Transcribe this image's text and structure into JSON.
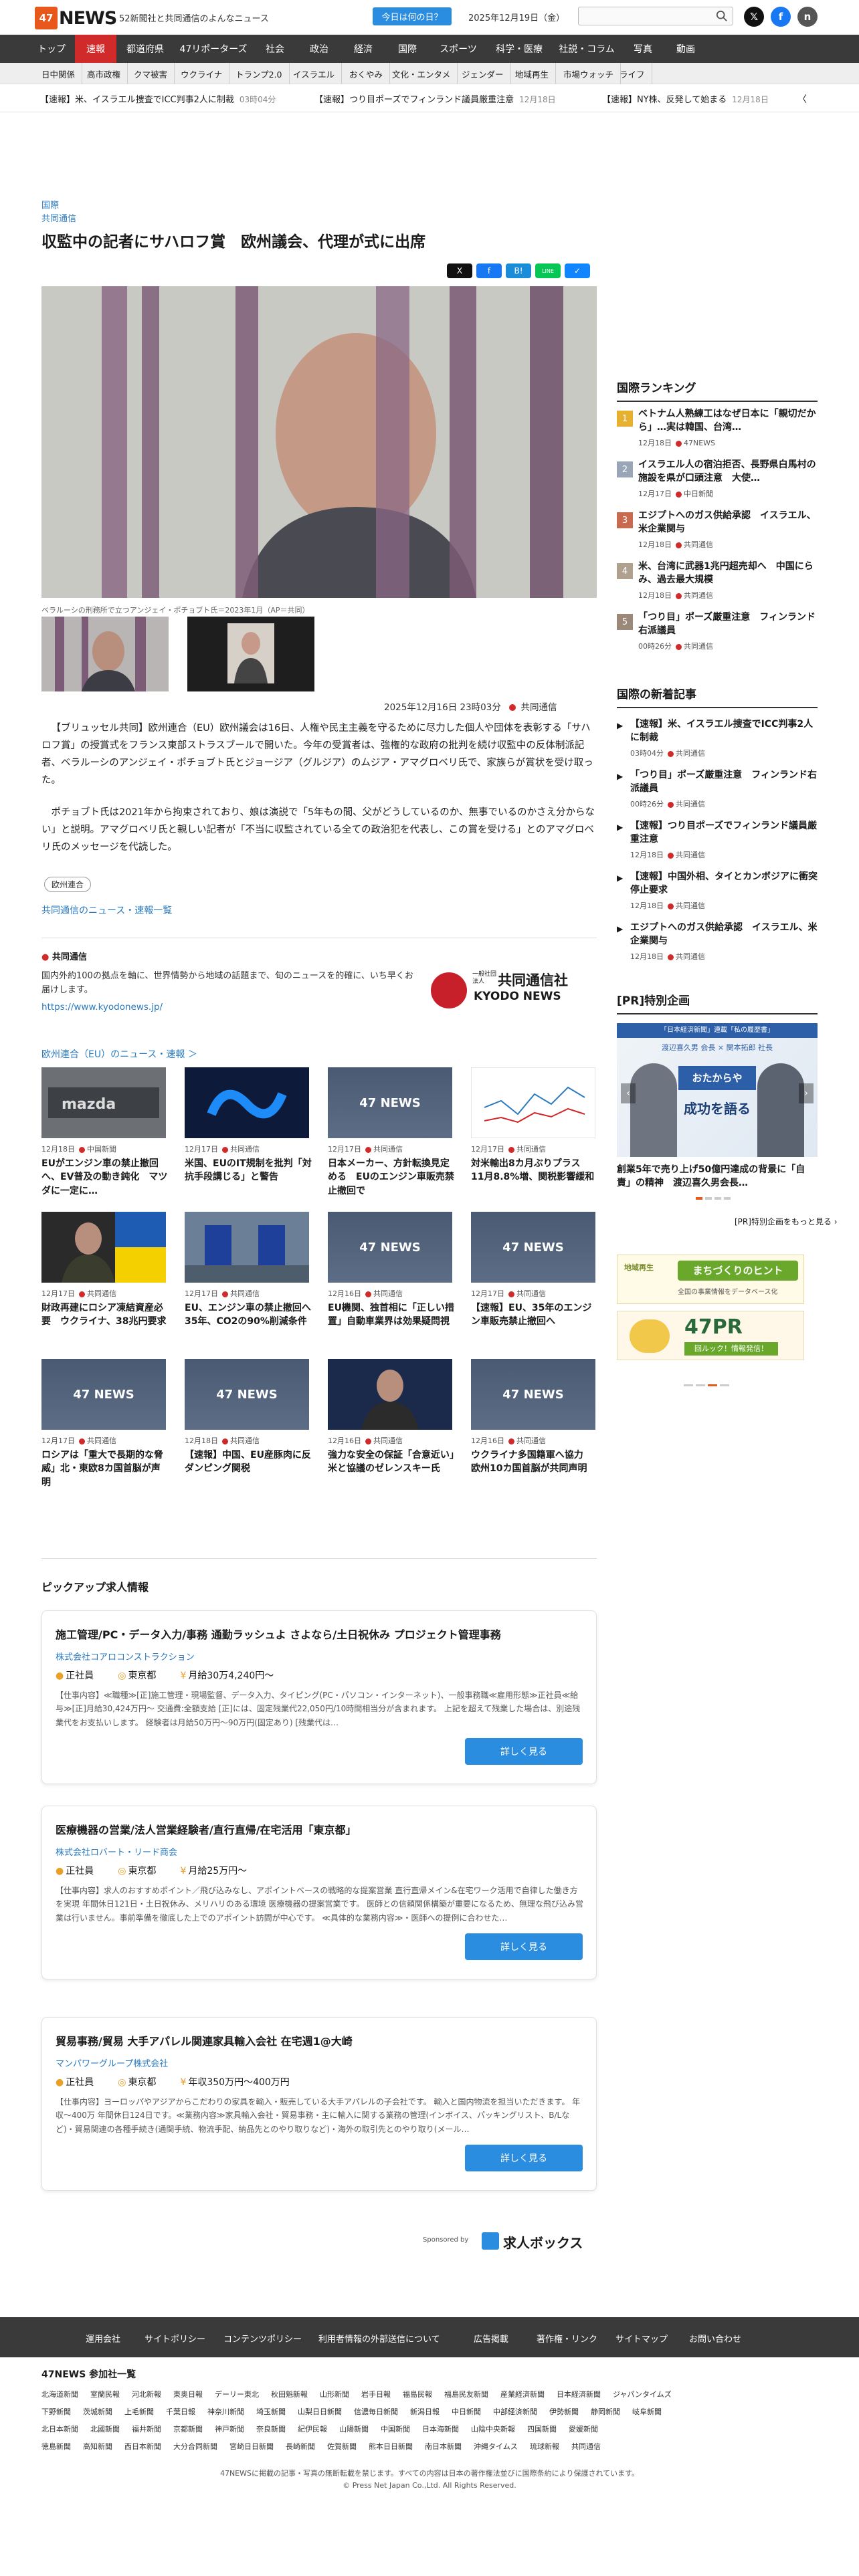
{
  "header": {
    "logo_mark": "47",
    "logo_text": "NEWS",
    "tagline": "52新聞社と共同通信のよんなニュース",
    "today_button": "今日は何の日？",
    "date": "2025年12月19日（金）",
    "search_placeholder": ""
  },
  "nav_main": [
    "トップ",
    "速報",
    "都道府県",
    "47リポーターズ",
    "社会",
    "政治",
    "経済",
    "国際",
    "スポーツ",
    "科学・医療",
    "社説・コラム",
    "写真",
    "動画"
  ],
  "nav_sub": [
    "日中関係",
    "高市政権",
    "クマ被害",
    "ウクライナ",
    "トランプ2.0",
    "イスラエル",
    "おくやみ",
    "文化・エンタメ",
    "ジェンダー",
    "地域再生",
    "市場ウォッチ",
    "ライフ"
  ],
  "ticker": [
    {
      "text": "【速報】米、イスラエル捜査でICC判事2人に制裁",
      "date": "03時04分"
    },
    {
      "text": "【速報】つり目ポーズでフィンランド議員厳重注意",
      "date": "12月18日"
    },
    {
      "text": "【速報】NY株、反発して始まる",
      "date": "12月18日"
    }
  ],
  "article": {
    "category": "国際",
    "source": "共同通信",
    "title": "収監中の記者にサハロフ賞　欧州議会、代理が式に出席",
    "caption": "ベラルーシの刑務所で立つアンジェイ・ポチョブト氏＝2023年1月（AP＝共同）",
    "datetime": "2025年12月16日 23時03分",
    "source_tag": "共同通信",
    "paragraphs": [
      "【ブリュッセル共同】欧州連合（EU）欧州議会は16日、人権や民主主義を守るために尽力した個人や団体を表彰する「サハロフ賞」の授賞式をフランス東部ストラスブールで開いた。今年の受賞者は、強権的な政府の批判を続け収監中の反体制派記者、ベラルーシのアンジェイ・ポチョブト氏とジョージア（グルジア）のムジア・アマグロベリ氏で、家族らが賞状を受け取った。",
      "ポチョブト氏は2021年から拘束されており、娘は演説で「5年もの間、父がどうしているのか、無事でいるのかさえ分からない」と説明。アマグロベリ氏と親しい記者が「不当に収監されている全ての政治犯を代表し、この賞を受ける」とのアマグロベリ氏のメッセージを代読した。"
    ],
    "tag": "欧州連合",
    "more_link": "共同通信のニュース・速報一覧",
    "share": [
      "X",
      "f",
      "B!",
      "LINE",
      "✓"
    ]
  },
  "kyodo": {
    "label": "共同通信",
    "desc": "国内外約100の拠点を軸に、世界情勢から地域の話題まで、旬のニュースを的確に、いち早くお届けします。",
    "url": "https://www.kyodonews.jp/",
    "logo_small": "一般社団法人",
    "logo_big": "共同通信社",
    "logo_en": "KYODO NEWS"
  },
  "eu_section": {
    "heading": "欧州連合（EU）のニュース・速報",
    "cards": [
      {
        "date": "12月18日",
        "src": "中国新聞",
        "title": "EUがエンジン車の禁止撤回へ、EV普及の動き鈍化　マツダに一定に…",
        "img": "mazda"
      },
      {
        "date": "12月17日",
        "src": "共同通信",
        "title": "米国、EUのIT規制を批判「対抗手段講じる」と警告",
        "img": "meta"
      },
      {
        "date": "12月17日",
        "src": "共同通信",
        "title": "日本メーカー、方針転換見定める　EUのエンジン車販売禁止撤回で",
        "img": "ph"
      },
      {
        "date": "12月17日",
        "src": "共同通信",
        "title": "対米輸出8カ月ぶりプラス　11月8.8%増、関税影響緩和",
        "img": "chart"
      },
      {
        "date": "12月17日",
        "src": "共同通信",
        "title": "財政再建にロシア凍結資産必要　ウクライナ、38兆円要求",
        "img": "zel"
      },
      {
        "date": "12月17日",
        "src": "共同通信",
        "title": "EU、エンジン車の禁止撤回へ　35年、CO2の90%削減条件",
        "img": "eu"
      },
      {
        "date": "12月16日",
        "src": "共同通信",
        "title": "EU機関、独首相に「正しい措置」自動車業界は効果疑問視",
        "img": "ph"
      },
      {
        "date": "12月17日",
        "src": "共同通信",
        "title": "【速報】EU、35年のエンジン車販売禁止撤回へ",
        "img": "ph"
      },
      {
        "date": "12月17日",
        "src": "共同通信",
        "title": "ロシアは「重大で長期的な脅威」北・東欧8カ国首脳が声明",
        "img": "ph"
      },
      {
        "date": "12月18日",
        "src": "共同通信",
        "title": "【速報】中国、EU産豚肉に反ダンピング関税",
        "img": "ph"
      },
      {
        "date": "12月16日",
        "src": "共同通信",
        "title": "強力な安全の保証「合意近い」米と協議のゼレンスキー氏",
        "img": "zel2"
      },
      {
        "date": "12月16日",
        "src": "共同通信",
        "title": "ウクライナ多国籍軍へ協力　欧州10カ国首脳が共同声明",
        "img": "ph"
      }
    ]
  },
  "ranking": {
    "heading": "国際ランキング",
    "items": [
      {
        "n": "1",
        "title": "ベトナム人熟練工はなぜ日本に「親切だから」…実は韓国、台湾…",
        "date": "12月18日",
        "src": "47NEWS"
      },
      {
        "n": "2",
        "title": "イスラエル人の宿泊拒否、長野県白馬村の施設を県が口頭注意　大使…",
        "date": "12月17日",
        "src": "中日新聞"
      },
      {
        "n": "3",
        "title": "エジプトへのガス供給承認　イスラエル、米企業関与",
        "date": "12月18日",
        "src": "共同通信"
      },
      {
        "n": "4",
        "title": "米、台湾に武器1兆円超売却へ　中国にらみ、過去最大規模",
        "date": "12月18日",
        "src": "共同通信"
      },
      {
        "n": "5",
        "title": "「つり目」ポーズ厳重注意　フィンランド右派議員",
        "date": "00時26分",
        "src": "共同通信"
      }
    ]
  },
  "newest": {
    "heading": "国際の新着記事",
    "items": [
      {
        "title": "【速報】米、イスラエル捜査でICC判事2人に制裁",
        "date": "03時04分",
        "src": "共同通信"
      },
      {
        "title": "「つり目」ポーズ厳重注意　フィンランド右派議員",
        "date": "00時26分",
        "src": "共同通信"
      },
      {
        "title": "【速報】つり目ポーズでフィンランド議員厳重注意",
        "date": "12月18日",
        "src": "共同通信"
      },
      {
        "title": "【速報】中国外相、タイとカンボジアに衝突停止要求",
        "date": "12月18日",
        "src": "共同通信"
      },
      {
        "title": "エジプトへのガス供給承認　イスラエル、米企業関与",
        "date": "12月18日",
        "src": "共同通信"
      }
    ]
  },
  "pr": {
    "heading": "[PR]特別企画",
    "banner_small": "「日本経済新聞」連載「私の履歴書」",
    "banner_names": "渡辺喜久男 会長 × 関本拓郎 社長",
    "banner_big": "おたからや",
    "banner_slogan": "成功を語る",
    "caption": "創業5年で売り上げ50億円達成の背景に「自責」の精神　渡辺喜久男会長…",
    "more": "[PR]特別企画をもっと見る",
    "ad1_small": "地域再生",
    "ad1_big": "まちづくりのヒント",
    "ad1_sub": "全国の事業情報をデータベース化",
    "ad2_big": "47PR",
    "ad2_sub": "回ルック！情報発信！"
  },
  "jobs": {
    "heading": "ピックアップ求人情報",
    "items": [
      {
        "title": "施工管理/PC・データ入力/事務 通勤ラッシュよ さよなら/土日祝休み プロジェクト管理事務",
        "company": "株式会社コアロコンストラクション",
        "type": "正社員",
        "place": "東京都",
        "pay": "月給30万4,240円〜",
        "desc": "【仕事内容】≪職種≫[正]施工管理・現場監督、データ入力、タイピング(PC・パソコン・インターネット)、一般事務職≪雇用形態≫正社員≪給与≫[正]月給30,424万円〜 交通費:全額支給 [正]には、固定残業代22,050円/10時間相当分が含まれます。 上記を超えて残業した場合は、別途残業代をお支払いします。 経験者は月給50万円〜90万円(固定あり) [残業代は…",
        "button": "詳しく見る"
      },
      {
        "title": "医療機器の営業/法人営業経験者/直行直帰/在宅活用「東京都」",
        "company": "株式会社ロバート・リード商会",
        "type": "正社員",
        "place": "東京都",
        "pay": "月給25万円〜",
        "desc": "【仕事内容】求人のおすすめポイント／飛び込みなし、アポイントベースの戦略的な提案営業 直行直帰メイン&在宅ワーク活用で自律した働き方を実現 年間休日121日・土日祝休み、メリハリのある環境 医療機器の提案営業です。 医師との信頼関係構築が重要になるため、無理な飛び込み営業は行いません。事前準備を徹底した上でのアポイント訪問が中心です。 ≪具体的な業務内容≫・医師への提例に合わせた…",
        "button": "詳しく見る"
      },
      {
        "title": "貿易事務/貿易 大手アパレル関連家具輸入会社 在宅週1@大崎",
        "company": "マンパワーグループ株式会社",
        "type": "正社員",
        "place": "東京都",
        "pay": "年収350万円〜400万円",
        "desc": "【仕事内容】ヨーロッパやアジアからこだわりの家具を輸入・販売している大手アパレルの子会社です。 輸入と国内物流を担当いただきます。 年収〜400万 年間休日124日です。≪業務内容≫家具輸入会社・貿易事務・主に輸入に関する業務の管理(インボイス、パッキングリスト、B/Lなど)・貿易関連の各種手続き(通関手続、物流手配、納品先とのやり取りなど)・海外の取引先とのやり取り(メール…",
        "button": "詳しく見る"
      }
    ],
    "sponsored": "Sponsored by",
    "sponsor": "求人ボックス"
  },
  "footer": {
    "links": [
      "運用会社",
      "サイトポリシー",
      "コンテンツポリシー",
      "利用者情報の外部送信について",
      "広告掲載",
      "著作権・リンク",
      "サイトマップ",
      "お問い合わせ"
    ],
    "partners_heading": "47NEWS 参加社一覧",
    "partners": [
      [
        "北海道新聞",
        "室蘭民報",
        "河北新報",
        "東奥日報",
        "デーリー東北",
        "秋田魁新報",
        "山形新聞",
        "岩手日報",
        "福島民報",
        "福島民友新聞",
        "産業経済新聞",
        "日本経済新聞",
        "ジャパンタイムズ"
      ],
      [
        "下野新聞",
        "茨城新聞",
        "上毛新聞",
        "千葉日報",
        "神奈川新聞",
        "埼玉新聞",
        "山梨日日新聞",
        "信濃毎日新聞",
        "新潟日報",
        "中日新聞",
        "中部経済新聞",
        "伊勢新聞",
        "静岡新聞",
        "岐阜新聞"
      ],
      [
        "北日本新聞",
        "北國新聞",
        "福井新聞",
        "京都新聞",
        "神戸新聞",
        "奈良新聞",
        "紀伊民報",
        "山陽新聞",
        "中国新聞",
        "日本海新聞",
        "山陰中央新報",
        "四国新聞",
        "愛媛新聞"
      ],
      [
        "徳島新聞",
        "高知新聞",
        "西日本新聞",
        "大分合同新聞",
        "宮崎日日新聞",
        "長崎新聞",
        "佐賀新聞",
        "熊本日日新聞",
        "南日本新聞",
        "沖縄タイムス",
        "琉球新報",
        "共同通信"
      ]
    ],
    "notice": "47NEWSに掲載の記事・写真の無断転載を禁じます。すべての内容は日本の著作権法並びに国際条約により保護されています。",
    "copyright": "© Press Net Japan Co.,Ltd. All Rights Reserved."
  },
  "colors": {
    "accent": "#d02a2a",
    "brand": "#e8581c",
    "link": "#2a7ac0",
    "button": "#2a8de0"
  }
}
